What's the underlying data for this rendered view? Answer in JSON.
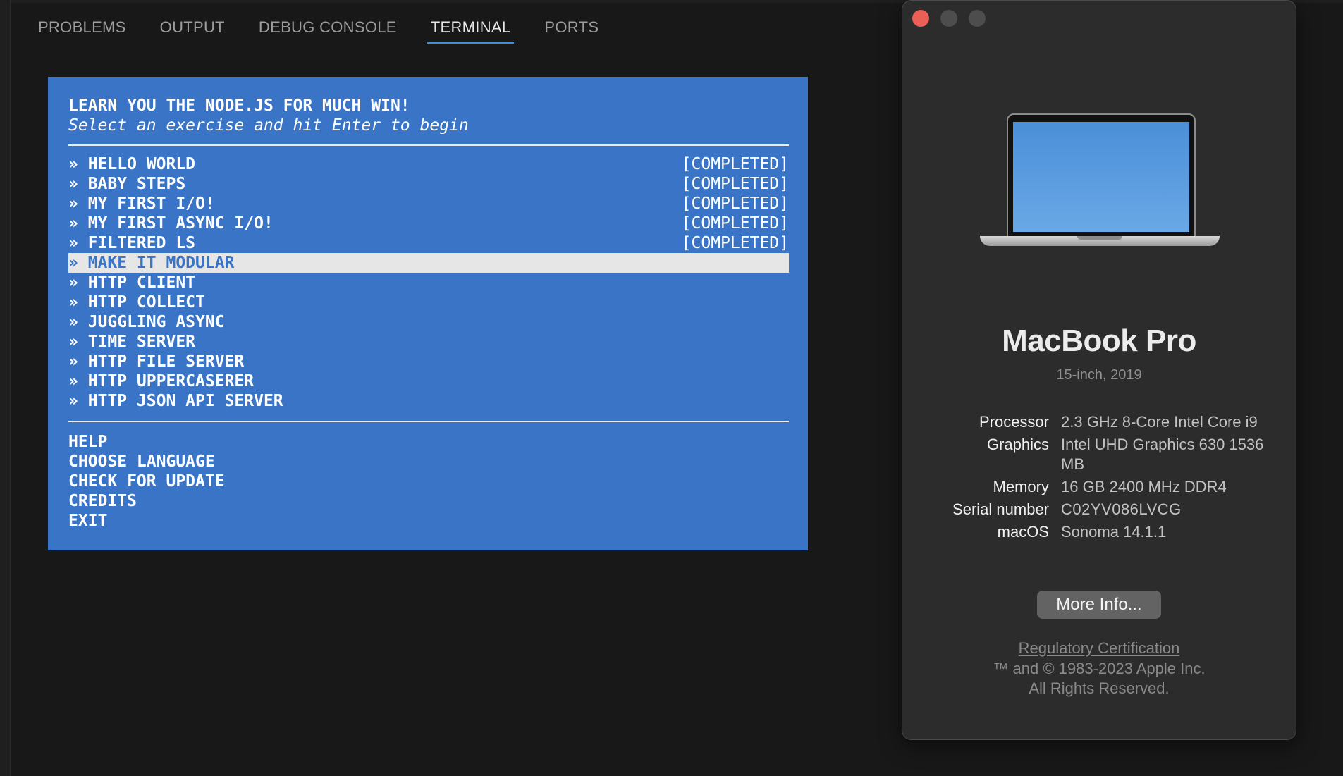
{
  "panel": {
    "tabs": [
      {
        "label": "PROBLEMS"
      },
      {
        "label": "OUTPUT"
      },
      {
        "label": "DEBUG CONSOLE"
      },
      {
        "label": "TERMINAL"
      },
      {
        "label": "PORTS"
      }
    ],
    "active_tab": "TERMINAL"
  },
  "terminal": {
    "title": "LEARN YOU THE NODE.JS FOR MUCH WIN!",
    "subtitle": "Select an exercise and hit Enter to begin",
    "exercises": [
      {
        "label": "» HELLO WORLD",
        "status": "[COMPLETED]"
      },
      {
        "label": "» BABY STEPS",
        "status": "[COMPLETED]"
      },
      {
        "label": "» MY FIRST I/O!",
        "status": "[COMPLETED]"
      },
      {
        "label": "» MY FIRST ASYNC I/O!",
        "status": "[COMPLETED]"
      },
      {
        "label": "» FILTERED LS",
        "status": "[COMPLETED]"
      },
      {
        "label": "» MAKE IT MODULAR",
        "status": ""
      },
      {
        "label": "» HTTP CLIENT",
        "status": ""
      },
      {
        "label": "» HTTP COLLECT",
        "status": ""
      },
      {
        "label": "» JUGGLING ASYNC",
        "status": ""
      },
      {
        "label": "» TIME SERVER",
        "status": ""
      },
      {
        "label": "» HTTP FILE SERVER",
        "status": ""
      },
      {
        "label": "» HTTP UPPERCASERER",
        "status": ""
      },
      {
        "label": "» HTTP JSON API SERVER",
        "status": ""
      }
    ],
    "selected_index": 5,
    "menu": [
      {
        "label": "HELP"
      },
      {
        "label": "CHOOSE LANGUAGE"
      },
      {
        "label": "CHECK FOR UPDATE"
      },
      {
        "label": "CREDITS"
      },
      {
        "label": "EXIT"
      }
    ]
  },
  "about": {
    "model": "MacBook Pro",
    "submodel": "15-inch, 2019",
    "specs": {
      "processor_key": "Processor",
      "processor_val": "2.3 GHz 8-Core Intel Core i9",
      "graphics_key": "Graphics",
      "graphics_val": "Intel UHD Graphics 630 1536 MB",
      "memory_key": "Memory",
      "memory_val": "16 GB 2400 MHz DDR4",
      "serial_key": "Serial number",
      "serial_val": "C02YV086LVCG",
      "macos_key": "macOS",
      "macos_val": "Sonoma 14.1.1"
    },
    "more_info_label": "More Info...",
    "regulatory_label": "Regulatory Certification",
    "copyright_line1": "™ and © 1983-2023 Apple Inc.",
    "copyright_line2": "All Rights Reserved."
  },
  "colors": {
    "terminal_bg": "#3a74c6",
    "selection_bg": "#e6e6e6",
    "tab_active_underline": "#3f8fd8",
    "close_button": "#ec5f57"
  },
  "icons": {
    "close": "close-icon",
    "minimize": "minimize-icon",
    "zoom": "zoom-icon",
    "device": "laptop-icon"
  }
}
